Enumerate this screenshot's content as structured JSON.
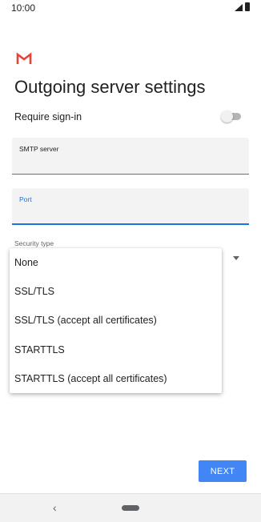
{
  "status_bar": {
    "time": "10:00",
    "icons": [
      "signal-icon",
      "battery-icon"
    ]
  },
  "app": {
    "logo": "gmail-logo"
  },
  "page": {
    "title": "Outgoing server settings"
  },
  "require_signin": {
    "label": "Require sign-in",
    "enabled": false
  },
  "smtp_field": {
    "label": "SMTP server",
    "value": ""
  },
  "port_field": {
    "label": "Port",
    "value": ""
  },
  "security_type": {
    "label": "Security type",
    "options": [
      "None",
      "SSL/TLS",
      "SSL/TLS (accept all certificates)",
      "STARTTLS",
      "STARTTLS (accept all certificates)"
    ]
  },
  "actions": {
    "next_label": "NEXT"
  },
  "colors": {
    "accent": "#1a73e8",
    "button": "#4285f4",
    "gmail_red": "#ea4335"
  },
  "nav_bar": {
    "back_icon": "back-chevron-icon",
    "home_icon": "home-pill-icon"
  }
}
